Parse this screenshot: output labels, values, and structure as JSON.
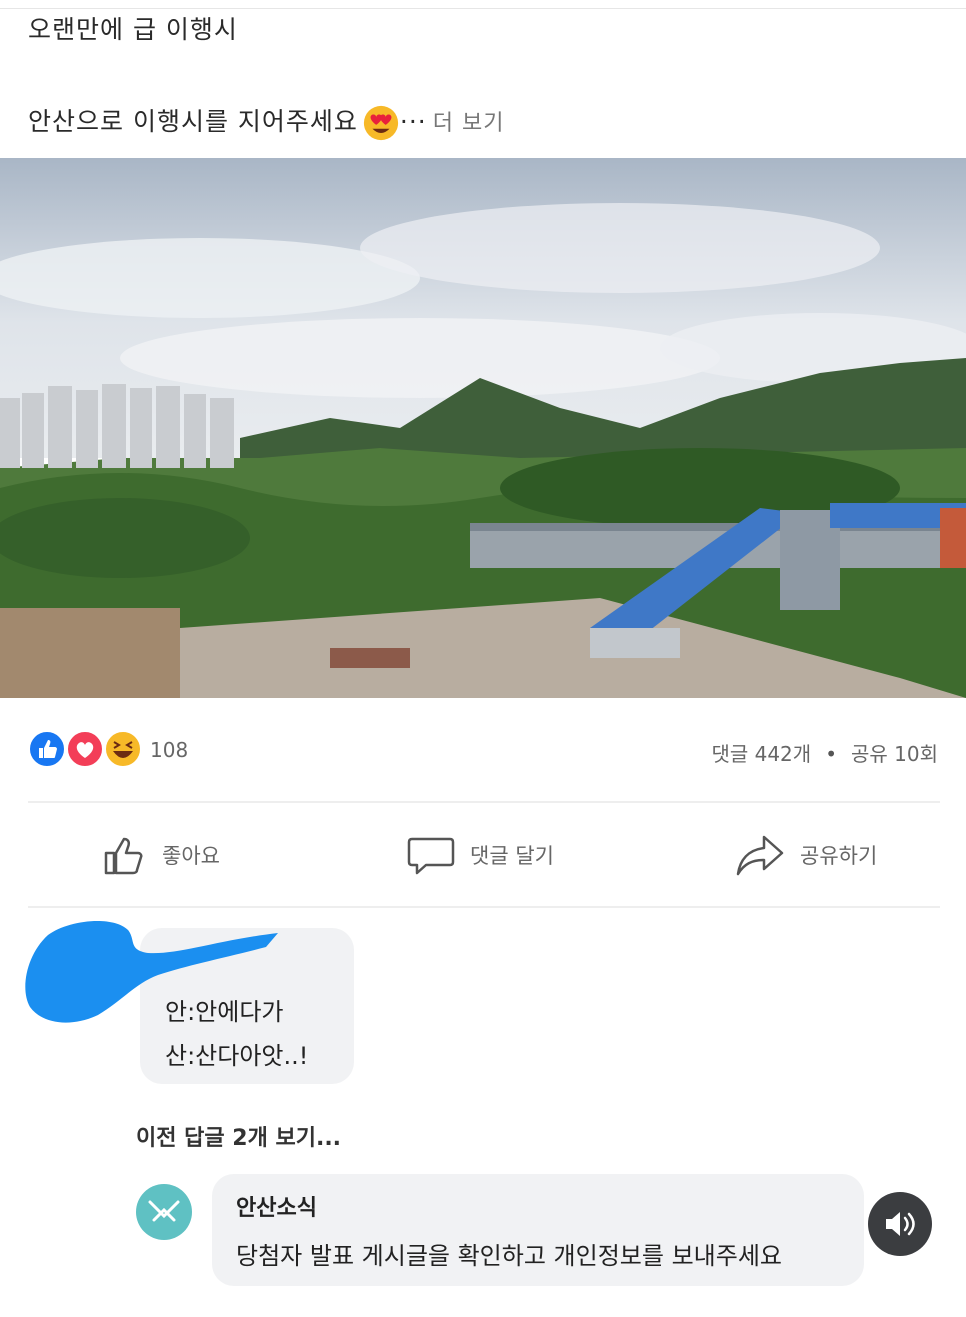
{
  "post": {
    "line1": "오랜만에 급 이행시",
    "line2": "안산으로 이행시를 지어주세요",
    "ellipsis": "···",
    "more": "더 보기"
  },
  "photo": {
    "icon": "landscape-photo"
  },
  "reactions": {
    "icons": [
      "like-icon",
      "love-icon",
      "haha-icon"
    ],
    "count": "108"
  },
  "stats": {
    "comments": "댓글 442개",
    "separator": "•",
    "shares": "공유 10회"
  },
  "actions": {
    "like": "좋아요",
    "comment": "댓글 달기",
    "share": "공유하기"
  },
  "comment1": {
    "line1": "안:안에다가",
    "line2": "산:산다아앗..!"
  },
  "prev_replies": "이전 답글 2개 보기...",
  "comment2": {
    "author": "안산소식",
    "text": "당첨자 발표 게시글을 확인하고 개인정보를 보내주세요"
  },
  "colors": {
    "like_blue": "#1877f2",
    "love_red": "#f33e58",
    "haha_yellow": "#f7b928",
    "scribble_blue": "#1b8ff0",
    "avatar_teal": "#5fc1c3"
  }
}
